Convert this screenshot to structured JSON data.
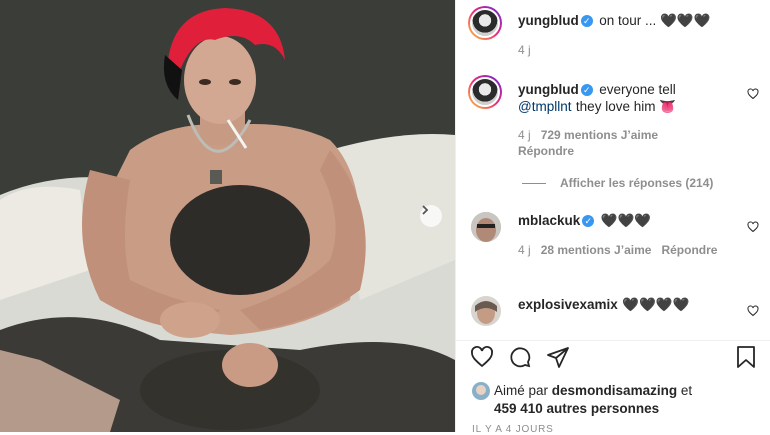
{
  "post": {
    "caption": {
      "username": "yungblud",
      "text": "on tour ... 🖤🖤🖤",
      "time": "4 j"
    },
    "comments": [
      {
        "username": "yungblud",
        "text_before": "everyone tell",
        "mention": "@tmpllnt",
        "text_after": "they love him 👅",
        "time": "4 j",
        "likes": "729 mentions J’aime",
        "reply": "Répondre",
        "view_replies": "Afficher les réponses (214)"
      },
      {
        "username": "mblackuk",
        "text": "🖤🖤🖤",
        "time": "4 j",
        "likes": "28 mentions J’aime",
        "reply": "Répondre"
      },
      {
        "username": "explosivexamix",
        "text": "🖤🖤🖤🖤"
      }
    ],
    "liked_by": {
      "prefix": "Aimé par",
      "user": "desmondisamazing",
      "joiner": "et",
      "others": "459 410 autres personnes"
    },
    "date": "IL Y A 4 JOURS"
  },
  "icons": {
    "like": "heart-icon",
    "comment": "comment-icon",
    "share": "paper-plane-icon",
    "save": "bookmark-icon",
    "next": "chevron-right-icon"
  },
  "colors": {
    "verified": "#3897f0",
    "hair": "#e0203a",
    "mention": "#00376b"
  }
}
